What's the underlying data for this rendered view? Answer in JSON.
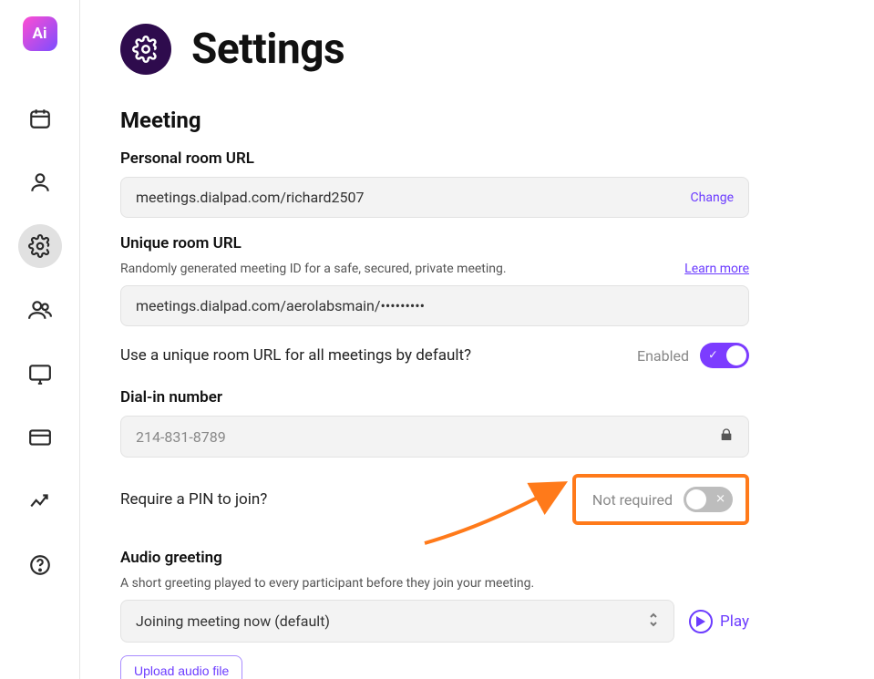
{
  "logo_text": "Ai",
  "page": {
    "title": "Settings"
  },
  "meeting": {
    "section_title": "Meeting",
    "personal_room": {
      "label": "Personal room URL",
      "value": "meetings.dialpad.com/richard2507",
      "change_label": "Change"
    },
    "unique_room": {
      "label": "Unique room URL",
      "description": "Randomly generated meeting ID for a safe, secured, private meeting.",
      "learn_more": "Learn more",
      "value": "meetings.dialpad.com/aerolabsmain/•••••••••"
    },
    "unique_default": {
      "question": "Use a unique room URL for all meetings by default?",
      "state_label": "Enabled"
    },
    "dial_in": {
      "label": "Dial-in number",
      "value": "214-831-8789"
    },
    "pin": {
      "question": "Require a PIN to join?",
      "state_label": "Not required"
    },
    "audio_greeting": {
      "label": "Audio greeting",
      "description": "A short greeting played to every participant before they join your meeting.",
      "selected": "Joining meeting now (default)",
      "play_label": "Play",
      "upload_label": "Upload audio file"
    }
  }
}
